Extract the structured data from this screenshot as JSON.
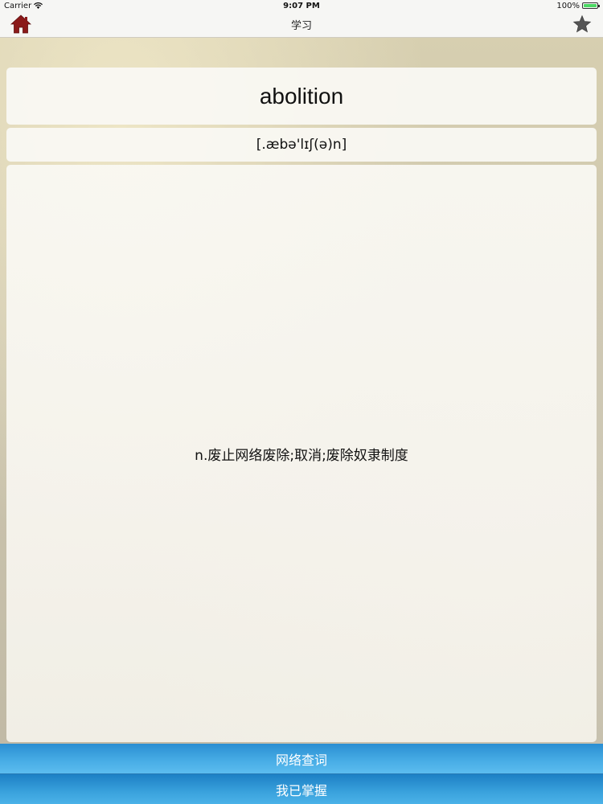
{
  "status_bar": {
    "carrier": "Carrier",
    "time": "9:07 PM",
    "battery": "100%",
    "battery_level": 1.0
  },
  "nav": {
    "title": "学习",
    "left_icon": "home-icon",
    "right_icon": "star-icon"
  },
  "word": {
    "text": "abolition",
    "phonetic": "[.æbə'lɪʃ(ə)n]",
    "definition": "n.废止网络废除;取消;废除奴隶制度"
  },
  "buttons": {
    "lookup": "网络查词",
    "mastered": "我已掌握"
  },
  "colors": {
    "home_icon": "#8b1a1a",
    "star_icon": "#555555",
    "button_blue": "#3aa2dd",
    "battery_green": "#4cd964"
  }
}
